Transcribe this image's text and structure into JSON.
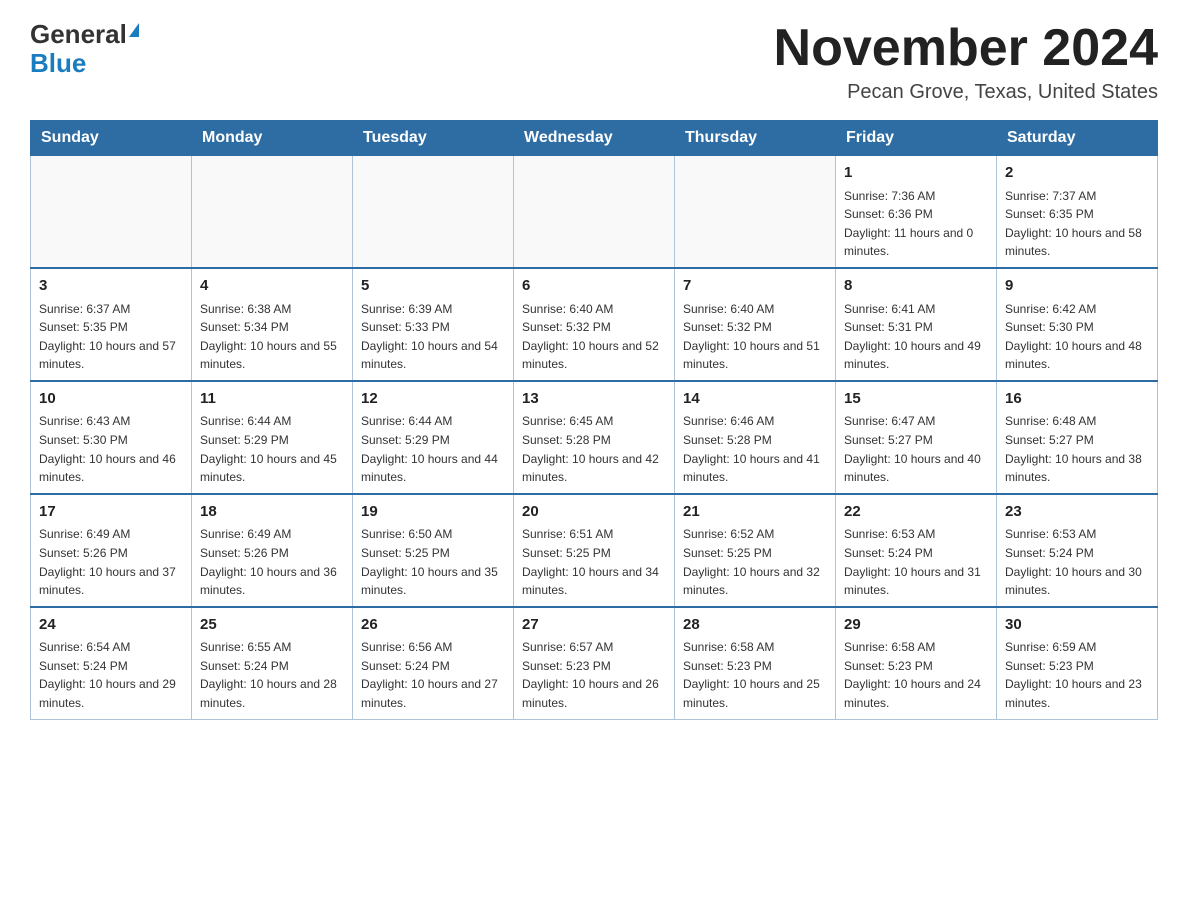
{
  "header": {
    "logo_general": "General",
    "logo_blue": "Blue",
    "month_title": "November 2024",
    "location": "Pecan Grove, Texas, United States"
  },
  "days_of_week": [
    "Sunday",
    "Monday",
    "Tuesday",
    "Wednesday",
    "Thursday",
    "Friday",
    "Saturday"
  ],
  "weeks": [
    [
      {
        "day": "",
        "sunrise": "",
        "sunset": "",
        "daylight": ""
      },
      {
        "day": "",
        "sunrise": "",
        "sunset": "",
        "daylight": ""
      },
      {
        "day": "",
        "sunrise": "",
        "sunset": "",
        "daylight": ""
      },
      {
        "day": "",
        "sunrise": "",
        "sunset": "",
        "daylight": ""
      },
      {
        "day": "",
        "sunrise": "",
        "sunset": "",
        "daylight": ""
      },
      {
        "day": "1",
        "sunrise": "Sunrise: 7:36 AM",
        "sunset": "Sunset: 6:36 PM",
        "daylight": "Daylight: 11 hours and 0 minutes."
      },
      {
        "day": "2",
        "sunrise": "Sunrise: 7:37 AM",
        "sunset": "Sunset: 6:35 PM",
        "daylight": "Daylight: 10 hours and 58 minutes."
      }
    ],
    [
      {
        "day": "3",
        "sunrise": "Sunrise: 6:37 AM",
        "sunset": "Sunset: 5:35 PM",
        "daylight": "Daylight: 10 hours and 57 minutes."
      },
      {
        "day": "4",
        "sunrise": "Sunrise: 6:38 AM",
        "sunset": "Sunset: 5:34 PM",
        "daylight": "Daylight: 10 hours and 55 minutes."
      },
      {
        "day": "5",
        "sunrise": "Sunrise: 6:39 AM",
        "sunset": "Sunset: 5:33 PM",
        "daylight": "Daylight: 10 hours and 54 minutes."
      },
      {
        "day": "6",
        "sunrise": "Sunrise: 6:40 AM",
        "sunset": "Sunset: 5:32 PM",
        "daylight": "Daylight: 10 hours and 52 minutes."
      },
      {
        "day": "7",
        "sunrise": "Sunrise: 6:40 AM",
        "sunset": "Sunset: 5:32 PM",
        "daylight": "Daylight: 10 hours and 51 minutes."
      },
      {
        "day": "8",
        "sunrise": "Sunrise: 6:41 AM",
        "sunset": "Sunset: 5:31 PM",
        "daylight": "Daylight: 10 hours and 49 minutes."
      },
      {
        "day": "9",
        "sunrise": "Sunrise: 6:42 AM",
        "sunset": "Sunset: 5:30 PM",
        "daylight": "Daylight: 10 hours and 48 minutes."
      }
    ],
    [
      {
        "day": "10",
        "sunrise": "Sunrise: 6:43 AM",
        "sunset": "Sunset: 5:30 PM",
        "daylight": "Daylight: 10 hours and 46 minutes."
      },
      {
        "day": "11",
        "sunrise": "Sunrise: 6:44 AM",
        "sunset": "Sunset: 5:29 PM",
        "daylight": "Daylight: 10 hours and 45 minutes."
      },
      {
        "day": "12",
        "sunrise": "Sunrise: 6:44 AM",
        "sunset": "Sunset: 5:29 PM",
        "daylight": "Daylight: 10 hours and 44 minutes."
      },
      {
        "day": "13",
        "sunrise": "Sunrise: 6:45 AM",
        "sunset": "Sunset: 5:28 PM",
        "daylight": "Daylight: 10 hours and 42 minutes."
      },
      {
        "day": "14",
        "sunrise": "Sunrise: 6:46 AM",
        "sunset": "Sunset: 5:28 PM",
        "daylight": "Daylight: 10 hours and 41 minutes."
      },
      {
        "day": "15",
        "sunrise": "Sunrise: 6:47 AM",
        "sunset": "Sunset: 5:27 PM",
        "daylight": "Daylight: 10 hours and 40 minutes."
      },
      {
        "day": "16",
        "sunrise": "Sunrise: 6:48 AM",
        "sunset": "Sunset: 5:27 PM",
        "daylight": "Daylight: 10 hours and 38 minutes."
      }
    ],
    [
      {
        "day": "17",
        "sunrise": "Sunrise: 6:49 AM",
        "sunset": "Sunset: 5:26 PM",
        "daylight": "Daylight: 10 hours and 37 minutes."
      },
      {
        "day": "18",
        "sunrise": "Sunrise: 6:49 AM",
        "sunset": "Sunset: 5:26 PM",
        "daylight": "Daylight: 10 hours and 36 minutes."
      },
      {
        "day": "19",
        "sunrise": "Sunrise: 6:50 AM",
        "sunset": "Sunset: 5:25 PM",
        "daylight": "Daylight: 10 hours and 35 minutes."
      },
      {
        "day": "20",
        "sunrise": "Sunrise: 6:51 AM",
        "sunset": "Sunset: 5:25 PM",
        "daylight": "Daylight: 10 hours and 34 minutes."
      },
      {
        "day": "21",
        "sunrise": "Sunrise: 6:52 AM",
        "sunset": "Sunset: 5:25 PM",
        "daylight": "Daylight: 10 hours and 32 minutes."
      },
      {
        "day": "22",
        "sunrise": "Sunrise: 6:53 AM",
        "sunset": "Sunset: 5:24 PM",
        "daylight": "Daylight: 10 hours and 31 minutes."
      },
      {
        "day": "23",
        "sunrise": "Sunrise: 6:53 AM",
        "sunset": "Sunset: 5:24 PM",
        "daylight": "Daylight: 10 hours and 30 minutes."
      }
    ],
    [
      {
        "day": "24",
        "sunrise": "Sunrise: 6:54 AM",
        "sunset": "Sunset: 5:24 PM",
        "daylight": "Daylight: 10 hours and 29 minutes."
      },
      {
        "day": "25",
        "sunrise": "Sunrise: 6:55 AM",
        "sunset": "Sunset: 5:24 PM",
        "daylight": "Daylight: 10 hours and 28 minutes."
      },
      {
        "day": "26",
        "sunrise": "Sunrise: 6:56 AM",
        "sunset": "Sunset: 5:24 PM",
        "daylight": "Daylight: 10 hours and 27 minutes."
      },
      {
        "day": "27",
        "sunrise": "Sunrise: 6:57 AM",
        "sunset": "Sunset: 5:23 PM",
        "daylight": "Daylight: 10 hours and 26 minutes."
      },
      {
        "day": "28",
        "sunrise": "Sunrise: 6:58 AM",
        "sunset": "Sunset: 5:23 PM",
        "daylight": "Daylight: 10 hours and 25 minutes."
      },
      {
        "day": "29",
        "sunrise": "Sunrise: 6:58 AM",
        "sunset": "Sunset: 5:23 PM",
        "daylight": "Daylight: 10 hours and 24 minutes."
      },
      {
        "day": "30",
        "sunrise": "Sunrise: 6:59 AM",
        "sunset": "Sunset: 5:23 PM",
        "daylight": "Daylight: 10 hours and 23 minutes."
      }
    ]
  ]
}
